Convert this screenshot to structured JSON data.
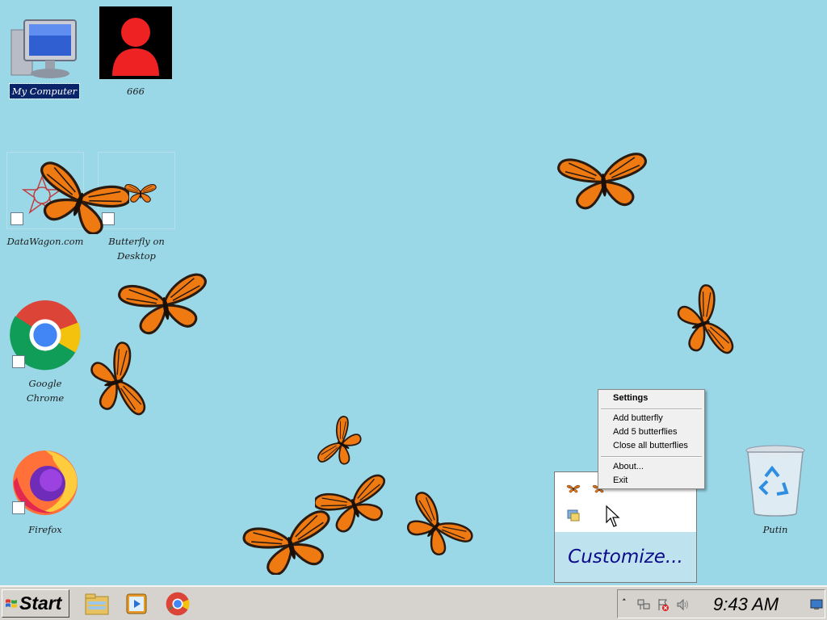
{
  "desktop": {
    "icons": [
      {
        "label": "My Computer",
        "icon": "computer-icon"
      },
      {
        "label": "666",
        "icon": "user-avatar-icon"
      },
      {
        "label": "DataWagon.com",
        "icon": "datawagon-icon"
      },
      {
        "label": "Butterfly on Desktop",
        "icon": "butterfly-icon"
      },
      {
        "label": "Google Chrome",
        "icon": "chrome-icon"
      },
      {
        "label": "Firefox",
        "icon": "firefox-icon"
      },
      {
        "label": "Putin",
        "icon": "recycle-bin-icon"
      }
    ]
  },
  "tray_popup": {
    "customize_label": "Customize..."
  },
  "context_menu": {
    "items": [
      {
        "label": "Settings"
      },
      {
        "label": "Add butterfly"
      },
      {
        "label": "Add 5 butterflies"
      },
      {
        "label": "Close all butterflies"
      },
      {
        "label": "About..."
      },
      {
        "label": "Exit"
      }
    ]
  },
  "taskbar": {
    "start_label": "Start",
    "quick_launch": [
      "explorer-icon",
      "media-player-icon",
      "chrome-icon"
    ],
    "tray_icons": [
      "network-icon",
      "action-center-icon",
      "volume-icon"
    ],
    "clock": "9:43 AM",
    "show_desktop_icon": "show-desktop-icon"
  },
  "colors": {
    "desktop_bg": "#9ad8e8",
    "butterfly_orange": "#f07a12",
    "taskbar_bg": "#d6d3ce",
    "selection": "#0a246a"
  }
}
